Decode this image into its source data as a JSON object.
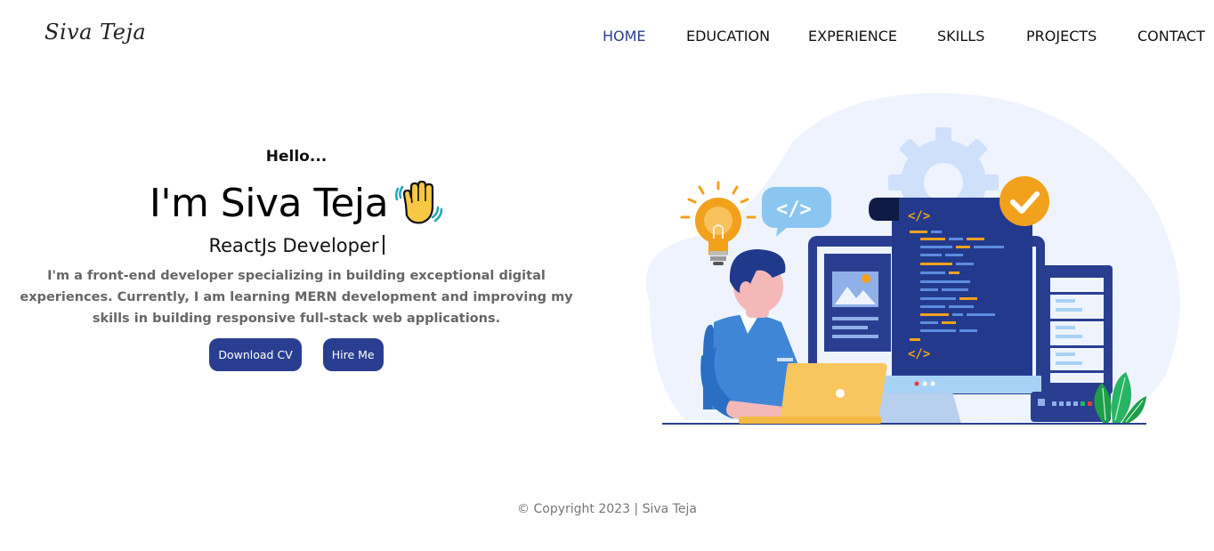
{
  "header": {
    "logo": "Siva Teja",
    "nav": [
      {
        "label": "HOME",
        "active": true
      },
      {
        "label": "EDUCATION",
        "active": false
      },
      {
        "label": "EXPERIENCE",
        "active": false
      },
      {
        "label": "SKILLS",
        "active": false
      },
      {
        "label": "PROJECTS",
        "active": false
      },
      {
        "label": "CONTACT",
        "active": false
      }
    ]
  },
  "hero": {
    "greeting": "Hello...",
    "name": "I'm Siva Teja",
    "role": "ReactJs Developer",
    "description": "I'm a front-end developer specializing in building exceptional digital experiences. Currently, I am learning MERN development and improving my skills in building responsive full-stack web applications.",
    "buttons": {
      "download_cv": "Download CV",
      "hire_me": "Hire Me"
    },
    "illustration_code_tag": "</>"
  },
  "footer": {
    "copyright": "© Copyright 2023 | Siva Teja"
  },
  "colors": {
    "accent": "#2a3e91",
    "nav_active": "#2c3e8c",
    "blob": "#eef3fd",
    "orange": "#f2a11d"
  }
}
